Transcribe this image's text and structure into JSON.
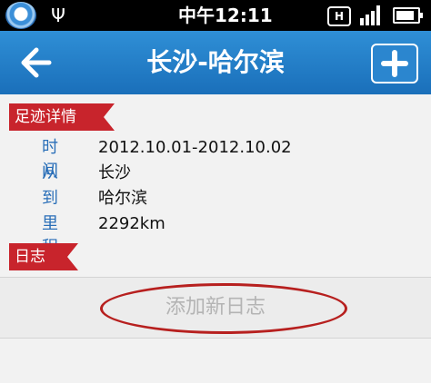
{
  "status_bar": {
    "time": "中午12:11",
    "network_label": "H",
    "battery_level": 0.85,
    "signal_bars": 4
  },
  "title_bar": {
    "title": "长沙-哈尔滨",
    "back_icon": "arrow-left-icon",
    "add_icon": "plus-icon"
  },
  "details": {
    "section_label": "足迹详情",
    "rows": [
      {
        "label": "时间",
        "value": "2012.10.01-2012.10.02"
      },
      {
        "label": "从",
        "value": "长沙"
      },
      {
        "label": "到",
        "value": "哈尔滨"
      },
      {
        "label": "里程",
        "value": "2292km"
      }
    ]
  },
  "log": {
    "section_label": "日志",
    "add_label": "添加新日志"
  },
  "colors": {
    "title_bar": "#1f7cc6",
    "section_tag": "#c8242c",
    "label_text": "#2a6fb8",
    "annotation_ellipse": "#b7201f"
  }
}
